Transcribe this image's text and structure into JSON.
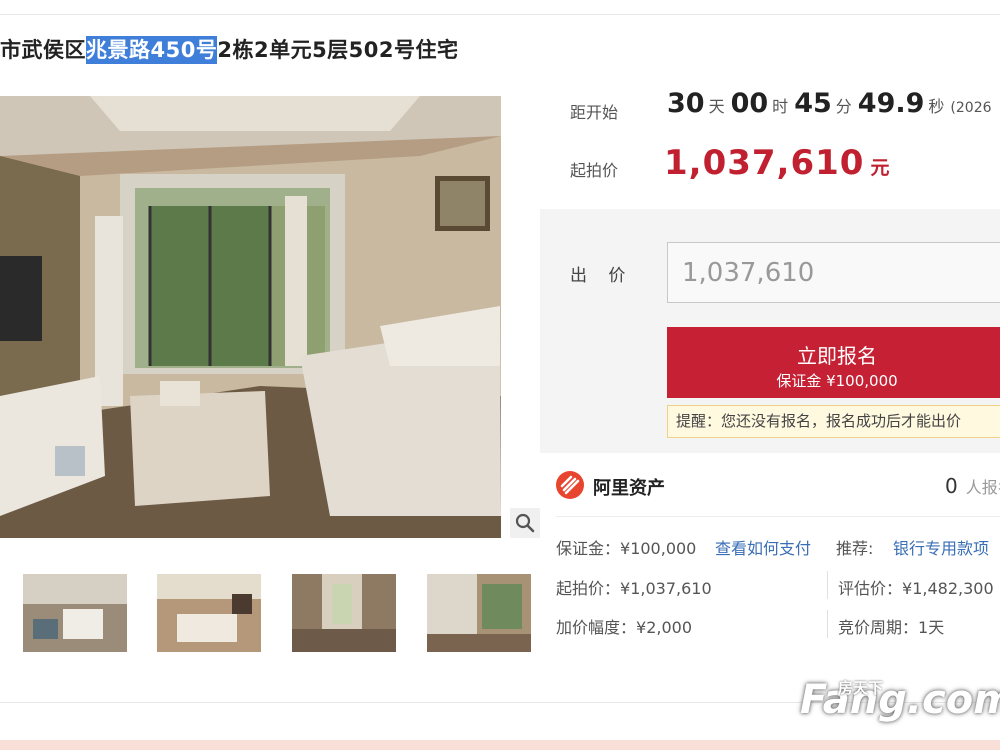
{
  "title": {
    "pre": "市武侯区",
    "highlight": "兆景路450号",
    "post": "2栋2单元5层502号住宅"
  },
  "countdown": {
    "label": "距开始",
    "days": "30",
    "days_unit": "天",
    "hours": "00",
    "hours_unit": "时",
    "minutes": "45",
    "minutes_unit": "分",
    "seconds": "49.9",
    "seconds_unit": "秒",
    "date_partial": "(2026"
  },
  "start_price": {
    "label": "起拍价",
    "value": "1,037,610",
    "unit": "元"
  },
  "bid": {
    "label": "出 价",
    "input_value": "1,037,610",
    "signup_label": "立即报名",
    "deposit_line": "保证金 ¥100,000",
    "notice": "提醒：您还没有报名，报名成功后才能出价"
  },
  "seller": {
    "name": "阿里资产",
    "count": "0",
    "count_unit": "人报名"
  },
  "details": {
    "deposit_label": "保证金：",
    "deposit_value": "¥100,000",
    "how_to_pay": "查看如何支付",
    "recommend_label": "推荐:",
    "recommend_link": "银行专用款项",
    "start_price_label": "起拍价：",
    "start_price_value": "¥1,037,610",
    "appraisal_label": "评估价：",
    "appraisal_value": "¥1,482,300",
    "increment_label": "加价幅度：",
    "increment_value": "¥2,000",
    "cycle_label": "竞价周期：",
    "cycle_value": "1天"
  },
  "icons": {
    "zoom": "magnifier-icon",
    "logo": "ali-assets-logo-icon"
  },
  "colors": {
    "accent_red": "#c52033",
    "price_red": "#c0202f",
    "link_blue": "#3a6eb5",
    "highlight_blue": "#3f7fd9"
  },
  "watermark": {
    "cn": "房天下",
    "en": "Fang.com"
  }
}
